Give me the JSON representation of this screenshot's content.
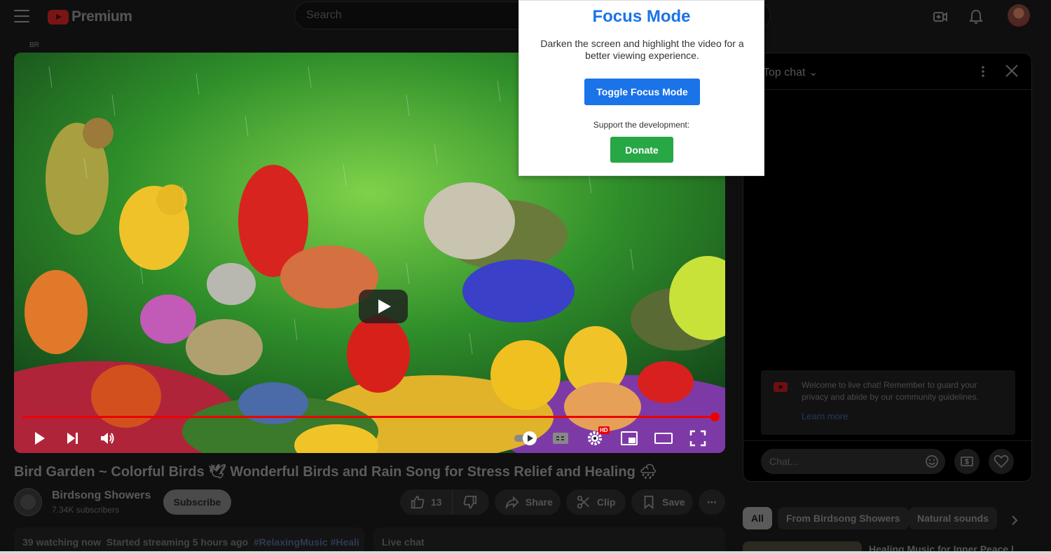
{
  "header": {
    "logo_text": "Premium",
    "region": "BR",
    "search_placeholder": "Search"
  },
  "video": {
    "title": "Bird Garden ~ Colorful Birds 🕊 Wonderful Birds and Rain Song for Stress Relief and Healing 🌧",
    "progress_percent": 100,
    "quality_badge": "HD"
  },
  "channel": {
    "name": "Birdsong Showers",
    "subscribers": "7.34K subscribers",
    "subscribe_label": "Subscribe"
  },
  "actions": {
    "likes": "13",
    "share": "Share",
    "clip": "Clip",
    "save": "Save",
    "more": "⋯"
  },
  "description": {
    "watching": "39 watching now",
    "started": "Started streaming 5 hours ago",
    "tags": "#RelaxingMusic #Heali"
  },
  "live_chat_label": "Live chat",
  "chat": {
    "header": "Top chat",
    "welcome": "Welcome to live chat! Remember to guard your privacy and abide by our community guidelines.",
    "learn_more": "Learn more",
    "input_placeholder": "Chat..."
  },
  "chips": [
    "All",
    "From Birdsong Showers",
    "Natural sounds"
  ],
  "recommendation": {
    "title": "Healing Music for Inner Peace |"
  },
  "popup": {
    "title": "Focus Mode",
    "description": "Darken the screen and highlight the video for a better viewing experience.",
    "toggle_label": "Toggle Focus Mode",
    "support_text": "Support the development:",
    "donate_label": "Donate"
  },
  "colors": {
    "popup_accent": "#1a73e8",
    "donate_green": "#28a745",
    "progress_red": "#ee0000"
  }
}
